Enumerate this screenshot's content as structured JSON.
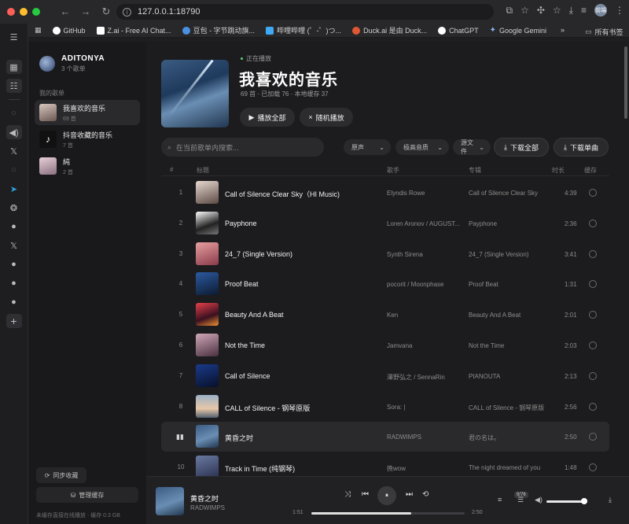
{
  "browser": {
    "url": "127.0.0.1:18790",
    "profile_badge": "前端",
    "bookmarks": [
      {
        "label": "GitHub",
        "color": "#ffffff"
      },
      {
        "label": "Z.ai - Free AI Chat...",
        "color": "#ffffff"
      },
      {
        "label": "豆包 - 字节跳动旗...",
        "color": "#4a90e2"
      },
      {
        "label": "哔哩哔哩 (゜-゜)つ...",
        "color": "#3fa9f5"
      },
      {
        "label": "Duck.ai 是由 Duck...",
        "color": "#de5833"
      },
      {
        "label": "ChatGPT",
        "color": "#ffffff"
      },
      {
        "label": "Google Gemini",
        "color": "#8ab4f8"
      }
    ],
    "bookmarks_more": "»",
    "all_bookmarks": "所有书签"
  },
  "user": {
    "name": "ADITONYA",
    "subtitle": "3 个歌单"
  },
  "sidebar": {
    "section_label": "我的歌单",
    "playlists": [
      {
        "title": "我喜欢的音乐",
        "count": "69 首"
      },
      {
        "title": "抖音收藏的音乐",
        "count": "7 首"
      },
      {
        "title": "純",
        "count": "2 首"
      }
    ],
    "sync_label": "同步收藏",
    "cache_label": "管理缓存",
    "footer_note": "未缓存直接在线播放 · 缓存 0.3 GB"
  },
  "playlist": {
    "now_label": "正在播放",
    "title": "我喜欢的音乐",
    "stats": "69 首 · 已加载 76 · 本地缓存 37",
    "play_all": "播放全部",
    "shuffle": "随机播放"
  },
  "toolbar": {
    "search_placeholder": "在当前歌单内搜索...",
    "select_source": "原声",
    "select_quality": "极高音质",
    "select_format": "源文件",
    "download_all": "下载全部",
    "download_single": "下载单曲"
  },
  "table": {
    "headers": {
      "index": "#",
      "title": "标题",
      "artist": "歌手",
      "album": "专辑",
      "duration": "时长",
      "cache": "缓存"
    },
    "rows": [
      {
        "index": "1",
        "title": "Call of Silence Clear Sky（HI Music)",
        "artist": "Elyndis Rowe",
        "album": "Call of Silence Clear Sky",
        "duration": "4:39"
      },
      {
        "index": "2",
        "title": "Payphone",
        "artist": "Loren Aronov / AUGUST...",
        "album": "Payphone",
        "duration": "2:36"
      },
      {
        "index": "3",
        "title": "24_7 (Single Version)",
        "artist": "Synth Sirena",
        "album": "24_7 (Single Version)",
        "duration": "3:41"
      },
      {
        "index": "4",
        "title": "Proof Beat",
        "artist": "pocorit / Moonphase",
        "album": "Proof Beat",
        "duration": "1:31"
      },
      {
        "index": "5",
        "title": "Beauty And A Beat",
        "artist": "Ken",
        "album": "Beauty And A Beat",
        "duration": "2:01"
      },
      {
        "index": "6",
        "title": "Not the Time",
        "artist": "Jamvana",
        "album": "Not the Time",
        "duration": "2:03"
      },
      {
        "index": "7",
        "title": "Call of Silence",
        "artist": "澤野弘之 / SennaRin",
        "album": "PIANOUTA",
        "duration": "2:13"
      },
      {
        "index": "8",
        "title": "CALL of Silence - 钢琴原版",
        "artist": "Sora: |",
        "album": "CALL of Silence - 钢琴原版",
        "duration": "2:56"
      },
      {
        "index": "",
        "title": "黄昏之时",
        "artist": "RADWIMPS",
        "album": "君の名は。",
        "duration": "2:50"
      },
      {
        "index": "10",
        "title": "Track in Time (纯钢琴)",
        "artist": "挽wow",
        "album": "The night dreamed of you",
        "duration": "1:48"
      }
    ]
  },
  "player": {
    "title": "黄昏之时",
    "artist": "RADWIMPS",
    "current_time": "1:51",
    "total_time": "2:50",
    "progress": 0.65,
    "queue_badge": "9/76",
    "volume": 0.92
  },
  "colors": {
    "accent_playing": "#5fd07a",
    "close": "#ff5f57",
    "minimize": "#febc2e",
    "maximize": "#28c840"
  }
}
